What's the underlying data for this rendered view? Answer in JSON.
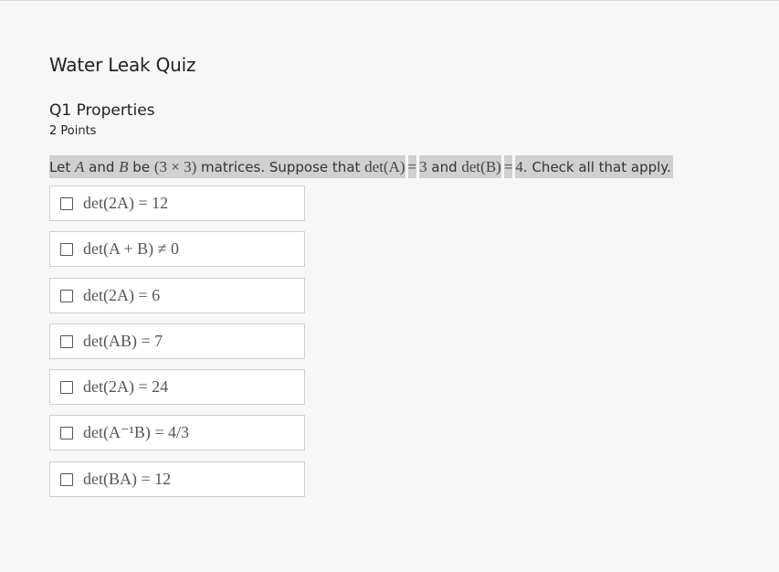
{
  "quiz": {
    "title": "Water Leak Quiz"
  },
  "question": {
    "title": "Q1 Properties",
    "points": "2 Points",
    "prompt": {
      "t1": "Let ",
      "m1": "A",
      "t2": " and ",
      "m2": "B",
      "t3": " be ",
      "m3": "(3 × 3)",
      "t4": " matrices. Suppose that ",
      "m4": "det(A)",
      "m5": "=",
      "m6": "3",
      "t5": " and ",
      "m7": "det(B)",
      "m8": "=",
      "m9": "4",
      "t6": ". Check all that apply."
    },
    "options": [
      {
        "label": "det(2A) = 12"
      },
      {
        "label": "det(A + B) ≠ 0"
      },
      {
        "label": "det(2A) = 6"
      },
      {
        "label": "det(AB) = 7"
      },
      {
        "label": "det(2A) = 24"
      },
      {
        "label": "det(A⁻¹B) = 4/3"
      },
      {
        "label": "det(BA) = 12"
      }
    ]
  }
}
